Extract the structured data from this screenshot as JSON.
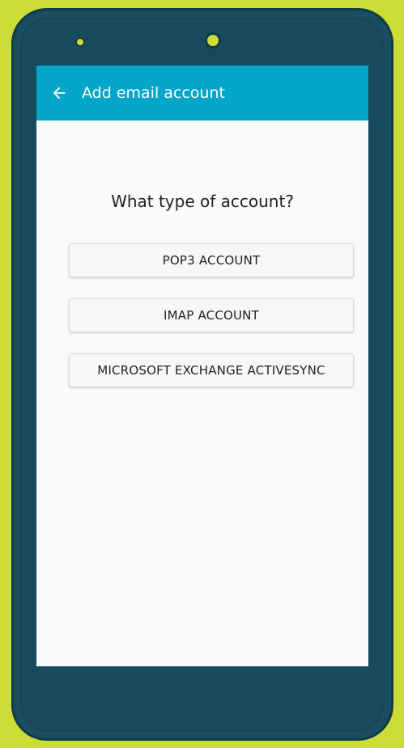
{
  "colors": {
    "background": "#cbdc36",
    "phone_body": "#1a4d5f",
    "toolbar": "#03a5c9",
    "screen": "#fafafa"
  },
  "toolbar": {
    "back_icon": "arrow-left-icon",
    "title": "Add email account"
  },
  "main": {
    "question": "What type of account?",
    "buttons": [
      {
        "label": "POP3 ACCOUNT"
      },
      {
        "label": "IMAP ACCOUNT"
      },
      {
        "label": "MICROSOFT EXCHANGE ACTIVESYNC"
      }
    ]
  }
}
